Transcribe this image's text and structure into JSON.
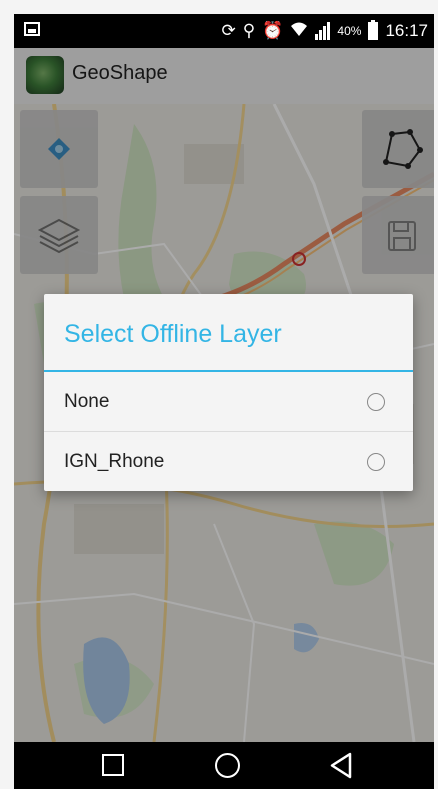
{
  "status_bar": {
    "battery_percent": "40%",
    "time": "16:17",
    "icons": [
      "image-icon",
      "sync-icon",
      "location-icon",
      "alarm-icon",
      "wifi-icon",
      "signal-icon",
      "battery-icon"
    ]
  },
  "app_bar": {
    "title": "GeoShape",
    "icon": "globe-app-icon"
  },
  "map_tools": {
    "left": [
      "locate-icon",
      "layers-icon"
    ],
    "right": [
      "polygon-draw-icon",
      "save-icon"
    ]
  },
  "dialog": {
    "title": "Select Offline Layer",
    "accent_color": "#33b5e5",
    "options": [
      {
        "label": "None",
        "selected": false
      },
      {
        "label": "IGN_Rhone",
        "selected": false
      }
    ]
  },
  "nav_bar": {
    "buttons": [
      "recent-apps-icon",
      "home-icon",
      "back-icon"
    ]
  }
}
